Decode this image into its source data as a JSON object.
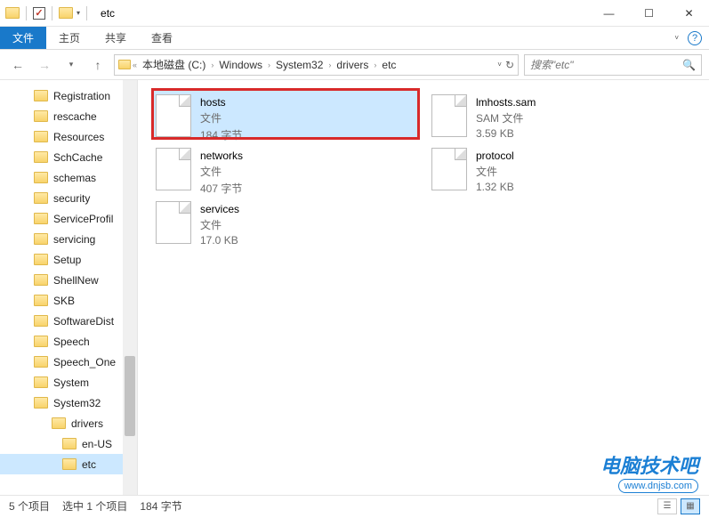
{
  "window": {
    "title": "etc",
    "min": "—",
    "max": "☐",
    "close": "✕"
  },
  "ribbon": {
    "file": "文件",
    "home": "主页",
    "share": "共享",
    "view": "查看"
  },
  "breadcrumb": {
    "root": "本地磁盘 (C:)",
    "p1": "Windows",
    "p2": "System32",
    "p3": "drivers",
    "p4": "etc"
  },
  "search": {
    "placeholder": "搜索\"etc\""
  },
  "tree": {
    "items": [
      {
        "label": "Registration",
        "lvl": 2
      },
      {
        "label": "rescache",
        "lvl": 2
      },
      {
        "label": "Resources",
        "lvl": 2
      },
      {
        "label": "SchCache",
        "lvl": 2
      },
      {
        "label": "schemas",
        "lvl": 2
      },
      {
        "label": "security",
        "lvl": 2
      },
      {
        "label": "ServiceProfil",
        "lvl": 2
      },
      {
        "label": "servicing",
        "lvl": 2
      },
      {
        "label": "Setup",
        "lvl": 2
      },
      {
        "label": "ShellNew",
        "lvl": 2
      },
      {
        "label": "SKB",
        "lvl": 2
      },
      {
        "label": "SoftwareDist",
        "lvl": 2
      },
      {
        "label": "Speech",
        "lvl": 2
      },
      {
        "label": "Speech_One",
        "lvl": 2
      },
      {
        "label": "System",
        "lvl": 2
      },
      {
        "label": "System32",
        "lvl": 2
      },
      {
        "label": "drivers",
        "lvl": 3
      },
      {
        "label": "en-US",
        "lvl": 4
      },
      {
        "label": "etc",
        "lvl": 4,
        "selected": true
      }
    ]
  },
  "files": [
    {
      "name": "hosts",
      "type": "文件",
      "size": "184 字节",
      "selected": true,
      "hl": true
    },
    {
      "name": "lmhosts.sam",
      "type": "SAM 文件",
      "size": "3.59 KB"
    },
    {
      "name": "networks",
      "type": "文件",
      "size": "407 字节"
    },
    {
      "name": "protocol",
      "type": "文件",
      "size": "1.32 KB"
    },
    {
      "name": "services",
      "type": "文件",
      "size": "17.0 KB"
    }
  ],
  "status": {
    "count": "5 个项目",
    "selection": "选中 1 个项目",
    "selsize": "184 字节"
  },
  "watermark": {
    "cn": "电脑技术吧",
    "url": "www.dnjsb.com"
  }
}
